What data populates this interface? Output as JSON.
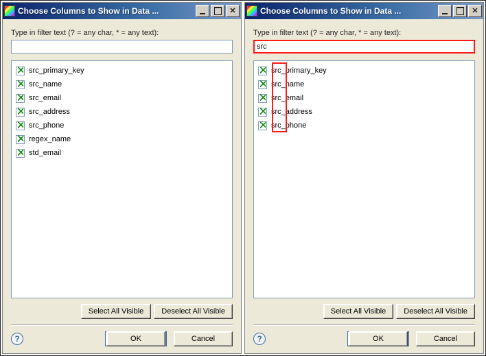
{
  "dialogs": [
    {
      "id": "left",
      "title": "Choose Columns to Show in Data ...",
      "filter_label": "Type in filter text (? = any char, * = any text):",
      "filter_value": "",
      "filter_highlight": false,
      "items": [
        {
          "label": "src_primary_key",
          "checked": true
        },
        {
          "label": "src_name",
          "checked": true
        },
        {
          "label": "src_email",
          "checked": true
        },
        {
          "label": "src_address",
          "checked": true
        },
        {
          "label": "src_phone",
          "checked": true
        },
        {
          "label": "regex_name",
          "checked": true
        },
        {
          "label": "std_email",
          "checked": true
        }
      ],
      "highlight_column": false,
      "buttons": {
        "select_all": "Select All Visible",
        "deselect_all": "Deselect All Visible",
        "ok": "OK",
        "cancel": "Cancel"
      }
    },
    {
      "id": "right",
      "title": "Choose Columns to Show in Data ...",
      "filter_label": "Type in filter text (? = any char, * = any text):",
      "filter_value": "src",
      "filter_highlight": true,
      "items": [
        {
          "label": "src_primary_key",
          "checked": true
        },
        {
          "label": "src_name",
          "checked": true
        },
        {
          "label": "src_email",
          "checked": true
        },
        {
          "label": "src_address",
          "checked": true
        },
        {
          "label": "src_phone",
          "checked": true
        }
      ],
      "highlight_column": true,
      "buttons": {
        "select_all": "Select All Visible",
        "deselect_all": "Deselect All Visible",
        "ok": "OK",
        "cancel": "Cancel"
      }
    }
  ],
  "window_controls": {
    "close_glyph": "✕"
  },
  "help_glyph": "?"
}
